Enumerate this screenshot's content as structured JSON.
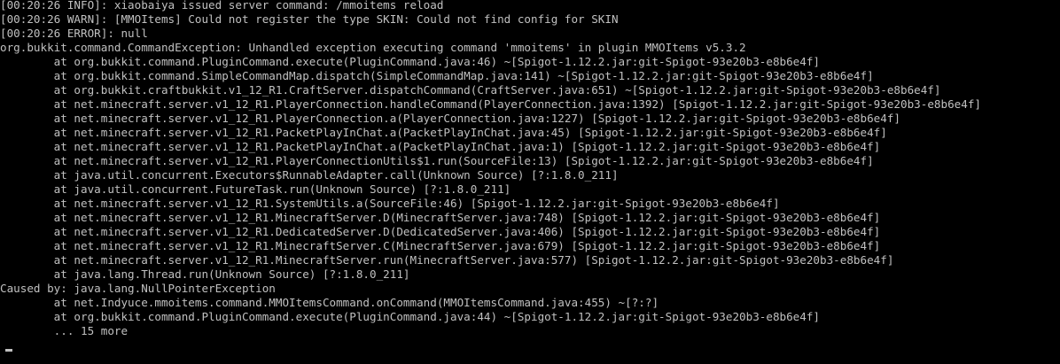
{
  "console": {
    "lines": [
      "[00:20:26 INFO]: xiaobaiya issued server command: /mmoitems reload",
      "[00:20:26 WARN]: [MMOItems] Could not register the type SKIN: Could not find config for SKIN",
      "[00:20:26 ERROR]: null",
      "org.bukkit.command.CommandException: Unhandled exception executing command 'mmoitems' in plugin MMOItems v5.3.2",
      "        at org.bukkit.command.PluginCommand.execute(PluginCommand.java:46) ~[Spigot-1.12.2.jar:git-Spigot-93e20b3-e8b6e4f]",
      "        at org.bukkit.command.SimpleCommandMap.dispatch(SimpleCommandMap.java:141) ~[Spigot-1.12.2.jar:git-Spigot-93e20b3-e8b6e4f]",
      "        at org.bukkit.craftbukkit.v1_12_R1.CraftServer.dispatchCommand(CraftServer.java:651) ~[Spigot-1.12.2.jar:git-Spigot-93e20b3-e8b6e4f]",
      "        at net.minecraft.server.v1_12_R1.PlayerConnection.handleCommand(PlayerConnection.java:1392) [Spigot-1.12.2.jar:git-Spigot-93e20b3-e8b6e4f]",
      "        at net.minecraft.server.v1_12_R1.PlayerConnection.a(PlayerConnection.java:1227) [Spigot-1.12.2.jar:git-Spigot-93e20b3-e8b6e4f]",
      "        at net.minecraft.server.v1_12_R1.PacketPlayInChat.a(PacketPlayInChat.java:45) [Spigot-1.12.2.jar:git-Spigot-93e20b3-e8b6e4f]",
      "        at net.minecraft.server.v1_12_R1.PacketPlayInChat.a(PacketPlayInChat.java:1) [Spigot-1.12.2.jar:git-Spigot-93e20b3-e8b6e4f]",
      "        at net.minecraft.server.v1_12_R1.PlayerConnectionUtils$1.run(SourceFile:13) [Spigot-1.12.2.jar:git-Spigot-93e20b3-e8b6e4f]",
      "        at java.util.concurrent.Executors$RunnableAdapter.call(Unknown Source) [?:1.8.0_211]",
      "        at java.util.concurrent.FutureTask.run(Unknown Source) [?:1.8.0_211]",
      "        at net.minecraft.server.v1_12_R1.SystemUtils.a(SourceFile:46) [Spigot-1.12.2.jar:git-Spigot-93e20b3-e8b6e4f]",
      "        at net.minecraft.server.v1_12_R1.MinecraftServer.D(MinecraftServer.java:748) [Spigot-1.12.2.jar:git-Spigot-93e20b3-e8b6e4f]",
      "        at net.minecraft.server.v1_12_R1.DedicatedServer.D(DedicatedServer.java:406) [Spigot-1.12.2.jar:git-Spigot-93e20b3-e8b6e4f]",
      "        at net.minecraft.server.v1_12_R1.MinecraftServer.C(MinecraftServer.java:679) [Spigot-1.12.2.jar:git-Spigot-93e20b3-e8b6e4f]",
      "        at net.minecraft.server.v1_12_R1.MinecraftServer.run(MinecraftServer.java:577) [Spigot-1.12.2.jar:git-Spigot-93e20b3-e8b6e4f]",
      "        at java.lang.Thread.run(Unknown Source) [?:1.8.0_211]",
      "Caused by: java.lang.NullPointerException",
      "        at net.Indyuce.mmoitems.command.MMOItemsCommand.onCommand(MMOItemsCommand.java:455) ~[?:?]",
      "        at org.bukkit.command.PluginCommand.execute(PluginCommand.java:44) ~[Spigot-1.12.2.jar:git-Spigot-93e20b3-e8b6e4f]",
      "        ... 15 more"
    ]
  },
  "colors": {
    "background": "#000000",
    "text": "#c0c0c0"
  }
}
